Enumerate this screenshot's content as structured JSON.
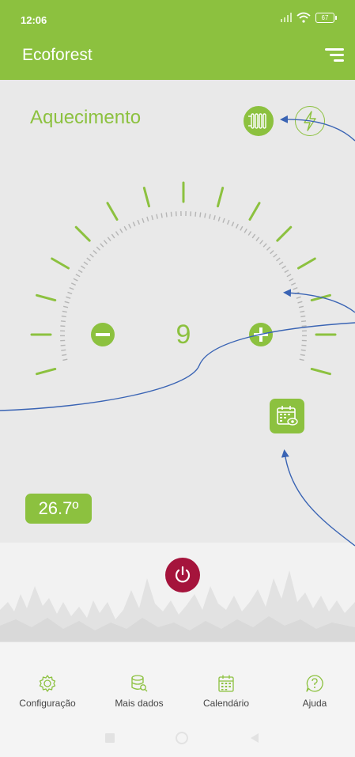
{
  "status": {
    "time": "12:06",
    "battery": "67"
  },
  "app": {
    "title": "Ecoforest"
  },
  "mode": {
    "title": "Aquecimento"
  },
  "gauge": {
    "value": "9",
    "minus": "−",
    "plus": "+"
  },
  "temperature": {
    "value": "26.7º"
  },
  "nav": [
    {
      "label": "Configuração",
      "icon": "gear-icon"
    },
    {
      "label": "Mais dados",
      "icon": "database-search-icon"
    },
    {
      "label": "Calendário",
      "icon": "calendar-icon"
    },
    {
      "label": "Ajuda",
      "icon": "help-icon"
    }
  ],
  "colors": {
    "accent": "#8cc13f",
    "power": "#a5143c",
    "annotation": "#3a64b4"
  }
}
